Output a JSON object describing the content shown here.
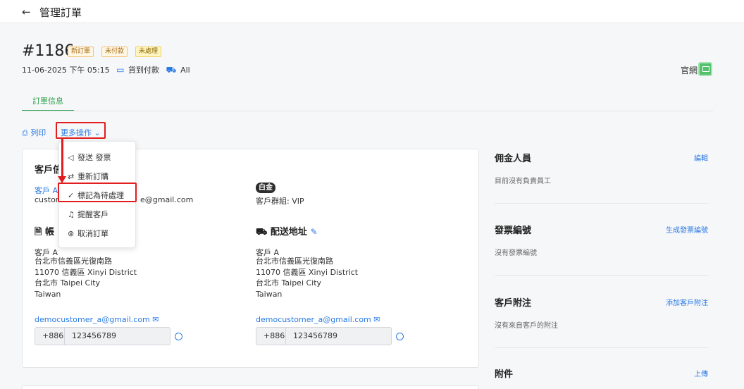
{
  "header": {
    "back_icon": "←",
    "title": "管理訂單"
  },
  "order": {
    "number": "#1186",
    "badges": [
      "新訂單",
      "未付款",
      "未處理"
    ],
    "datetime": "11-06-2025 下午 05:15",
    "payment": "貨到付款",
    "delivery": "All",
    "channel_label": "官網"
  },
  "tabs": {
    "order_info": "訂單信息"
  },
  "actions": {
    "print": "列印",
    "more": "更多操作"
  },
  "dropdown": {
    "items": [
      {
        "icon": "send-icon",
        "glyph": "◁",
        "label": "發送 發票"
      },
      {
        "icon": "reorder-icon",
        "glyph": "⇄",
        "label": "重新訂購"
      },
      {
        "icon": "check-icon",
        "glyph": "✓",
        "label": "標記為待處理"
      },
      {
        "icon": "bell-icon",
        "glyph": "♫",
        "label": "提醒客戶"
      },
      {
        "icon": "cancel-circle-icon",
        "glyph": "⊗",
        "label": "取消訂單"
      }
    ]
  },
  "customer": {
    "section_title_partial": "客戶信",
    "name_partial": "客戶 A",
    "email_partial_left": "custom",
    "email_partial_right": "e@gmail.com",
    "tier": "白金",
    "group": "客戶群組: VIP"
  },
  "billing": {
    "title_partial": "帳",
    "name": "客戶 A",
    "lines": [
      "台北市信義區光復南路",
      "11070 信義區 Xinyi District",
      "台北市 Taipei City",
      "Taiwan"
    ],
    "email": "democustomer_a@gmail.com",
    "phone_code": "+886",
    "phone": "123456789"
  },
  "shipping": {
    "title": "配送地址",
    "name": "客戶 A",
    "lines": [
      "台北市信義區光復南路",
      "11070 信義區 Xinyi District",
      "台北市 Taipei City",
      "Taiwan"
    ],
    "email": "democustomer_a@gmail.com",
    "phone_code": "+886",
    "phone": "123456789"
  },
  "sidebar": {
    "commission": {
      "title": "佣金人員",
      "action": "編輯",
      "empty": "目前沒有負責員工"
    },
    "invoice": {
      "title": "發票編號",
      "action": "生成發票編號",
      "empty": "沒有發票編號"
    },
    "notes": {
      "title": "客戶附注",
      "action": "添加客戶附注",
      "empty": "沒有來自客戶的附注"
    },
    "attachments": {
      "title": "附件",
      "action": "上傳"
    }
  },
  "colors": {
    "accent_blue": "#2a7ae4",
    "accent_green": "#2ca24b",
    "highlight_red": "#e11d1d"
  }
}
